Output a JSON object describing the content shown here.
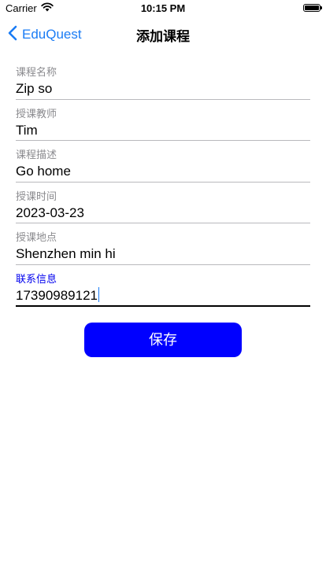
{
  "status_bar": {
    "carrier": "Carrier",
    "time": "10:15 PM"
  },
  "nav": {
    "back_label": "EduQuest",
    "title": "添加课程"
  },
  "form": {
    "fields": [
      {
        "label": "课程名称",
        "value": "Zip so"
      },
      {
        "label": "授课教师",
        "value": "Tim"
      },
      {
        "label": "课程描述",
        "value": "Go home"
      },
      {
        "label": "授课时间",
        "value": "2023-03-23"
      },
      {
        "label": "授课地点",
        "value": "Shenzhen min hi"
      },
      {
        "label": "联系信息",
        "value": "17390989121"
      }
    ]
  },
  "save_label": "保存",
  "colors": {
    "accent": "#1a7cf5",
    "button": "#0000ff",
    "active_label": "#0000ee"
  },
  "battery_level": 1.0
}
